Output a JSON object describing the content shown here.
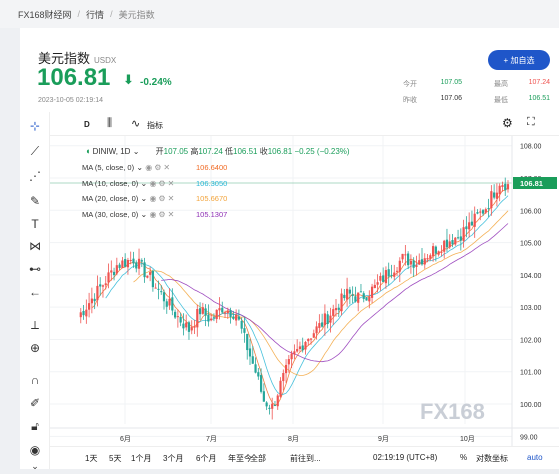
{
  "breadcrumb": [
    "FX168财经网",
    "行情",
    "美元指数"
  ],
  "header": {
    "title": "美元指数",
    "symbol": "USDX",
    "price": "106.81",
    "change": "-0.24%",
    "datetime": "2023-10-05 02:19:14",
    "add_button": "+ 加自选"
  },
  "quotes": {
    "open_label": "今开",
    "open": "107.05",
    "high_label": "最高",
    "high": "107.24",
    "prev_label": "昨收",
    "prev": "107.06",
    "low_label": "最低",
    "low": "106.51"
  },
  "colors": {
    "up": "#ef5350",
    "down": "#26a69a",
    "brand": "#1f56c9",
    "price_green": "#1a9d5a"
  },
  "chart_toolbar": {
    "interval": "D",
    "indicator_label": "指标"
  },
  "ohlc": {
    "symbol": "DINIW, 1D",
    "open_label": "开",
    "open": "107.05",
    "high_label": "高",
    "high": "107.24",
    "low_label": "低",
    "low": "106.51",
    "close_label": "收",
    "close": "106.81",
    "change": "−0.25 (−0.23%)"
  },
  "ma": [
    {
      "label": "MA (5, close, 0)",
      "value": "106.6400",
      "color": "#f06a24"
    },
    {
      "label": "MA (10, close, 0)",
      "value": "106.3050",
      "color": "#26b6d6"
    },
    {
      "label": "MA (20, close, 0)",
      "value": "105.6670",
      "color": "#f2a33a"
    },
    {
      "label": "MA (30, close, 0)",
      "value": "105.1307",
      "color": "#8e2fb5"
    }
  ],
  "chart_data": {
    "type": "candlestick",
    "y_axis_ticks": [
      "108.00",
      "107.00",
      "106.00",
      "105.00",
      "104.00",
      "103.00",
      "102.00",
      "101.00",
      "100.00",
      "99.00"
    ],
    "ylim": [
      98.7,
      108.3
    ],
    "x_axis_ticks": [
      "6月",
      "7月",
      "8月",
      "9月",
      "10月"
    ],
    "last_price_label": "106.81",
    "watermark": "FX168"
  },
  "bottom": {
    "ranges": [
      "1天",
      "5天",
      "1个月",
      "3个月",
      "6个月",
      "年至今",
      "全部"
    ],
    "goto": "前往到...",
    "clock": "02:19:19 (UTC+8)",
    "percent": "%",
    "log_scale": "对数坐标",
    "auto": "auto"
  }
}
